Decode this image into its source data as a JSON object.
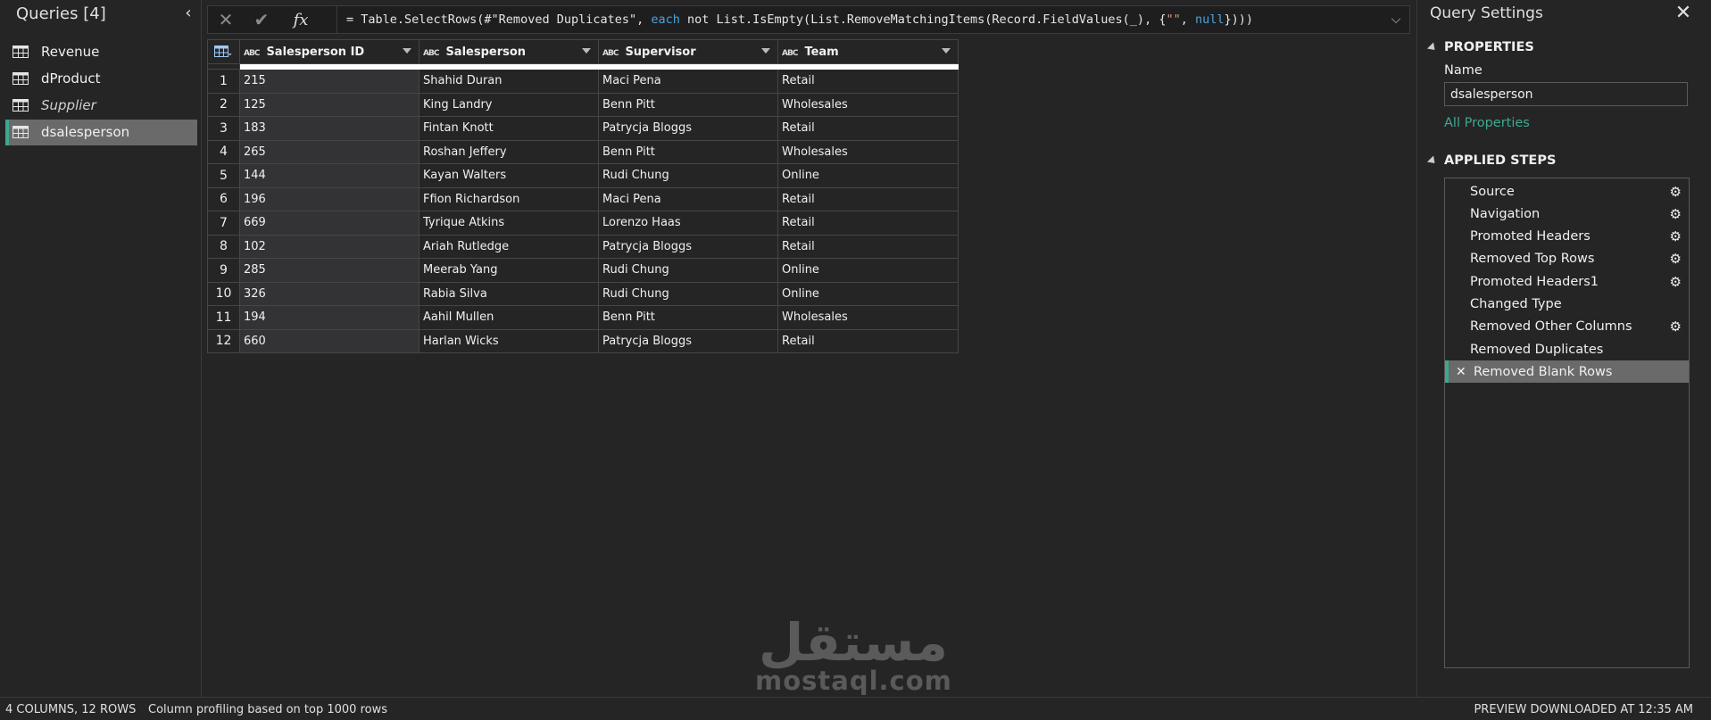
{
  "queries": {
    "title": "Queries [4]",
    "items": [
      {
        "label": "Revenue",
        "selected": false,
        "italic": false
      },
      {
        "label": "dProduct",
        "selected": false,
        "italic": false
      },
      {
        "label": "Supplier",
        "selected": false,
        "italic": true
      },
      {
        "label": "dsalesperson",
        "selected": true,
        "italic": false
      }
    ]
  },
  "formula_bar": {
    "cancel_icon": "close-icon",
    "commit_icon": "check-icon",
    "fx_label": "fx",
    "formula": "= Table.SelectRows(#\"Removed Duplicates\", each not List.IsEmpty(List.RemoveMatchingItems(Record.FieldValues(_), {\"\", null})))"
  },
  "grid": {
    "columns": [
      {
        "type": "ABC",
        "name": "Salesperson ID"
      },
      {
        "type": "ABC",
        "name": "Salesperson"
      },
      {
        "type": "ABC",
        "name": "Supervisor"
      },
      {
        "type": "ABC",
        "name": "Team"
      }
    ],
    "rows": [
      [
        "1",
        "215",
        "Shahid Duran",
        "Maci Pena",
        "Retail"
      ],
      [
        "2",
        "125",
        "King Landry",
        "Benn Pitt",
        "Wholesales"
      ],
      [
        "3",
        "183",
        "Fintan Knott",
        "Patrycja Bloggs",
        "Retail"
      ],
      [
        "4",
        "265",
        "Roshan Jeffery",
        "Benn Pitt",
        "Wholesales"
      ],
      [
        "5",
        "144",
        "Kayan Walters",
        "Rudi Chung",
        "Online"
      ],
      [
        "6",
        "196",
        "Ffion Richardson",
        "Maci Pena",
        "Retail"
      ],
      [
        "7",
        "669",
        "Tyrique Atkins",
        "Lorenzo Haas",
        "Retail"
      ],
      [
        "8",
        "102",
        "Ariah Rutledge",
        "Patrycja Bloggs",
        "Retail"
      ],
      [
        "9",
        "285",
        "Meerab Yang",
        "Rudi Chung",
        "Online"
      ],
      [
        "10",
        "326",
        "Rabia Silva",
        "Rudi Chung",
        "Online"
      ],
      [
        "11",
        "194",
        "Aahil Mullen",
        "Benn Pitt",
        "Wholesales"
      ],
      [
        "12",
        "660",
        "Harlan Wicks",
        "Patrycja Bloggs",
        "Retail"
      ]
    ]
  },
  "settings": {
    "title": "Query Settings",
    "properties_heading": "PROPERTIES",
    "name_label": "Name",
    "name_value": "dsalesperson",
    "all_properties": "All Properties",
    "steps_heading": "APPLIED STEPS",
    "steps": [
      {
        "label": "Source",
        "gear": true
      },
      {
        "label": "Navigation",
        "gear": true
      },
      {
        "label": "Promoted Headers",
        "gear": true
      },
      {
        "label": "Removed Top Rows",
        "gear": true
      },
      {
        "label": "Promoted Headers1",
        "gear": true
      },
      {
        "label": "Changed Type",
        "gear": false
      },
      {
        "label": "Removed Other Columns",
        "gear": true
      },
      {
        "label": "Removed Duplicates",
        "gear": false
      },
      {
        "label": "Removed Blank Rows",
        "gear": false,
        "selected": true
      }
    ]
  },
  "status": {
    "summary": "4 COLUMNS, 12 ROWS",
    "profiling": "Column profiling based on top 1000 rows",
    "preview": "PREVIEW DOWNLOADED AT 12:35 AM"
  },
  "watermark": {
    "arabic": "مستقل",
    "latin": "mostaql.com"
  },
  "colors": {
    "accent": "#3ea88e",
    "background": "#252526",
    "selected": "#6a6a6a"
  }
}
